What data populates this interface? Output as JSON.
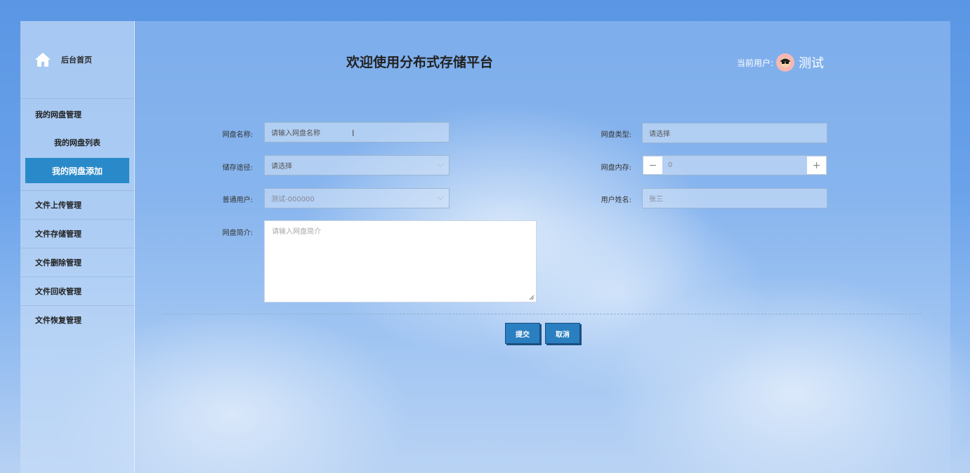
{
  "sidebar": {
    "home_label": "后台首页",
    "groups": [
      {
        "label": "我的网盘管理",
        "items": [
          {
            "label": "我的网盘列表"
          },
          {
            "label": "我的网盘添加"
          }
        ]
      }
    ],
    "menu": [
      {
        "label": "文件上传管理"
      },
      {
        "label": "文件存储管理"
      },
      {
        "label": "文件删除管理"
      },
      {
        "label": "文件回收管理"
      },
      {
        "label": "文件恢复管理"
      }
    ]
  },
  "header": {
    "title": "欢迎使用分布式存储平台",
    "current_user_label": "当前用户:",
    "current_user_name": "测试"
  },
  "form": {
    "disk_name": {
      "label": "网盘名称:",
      "placeholder": "请输入网盘名称"
    },
    "disk_type": {
      "label": "网盘类型:",
      "value": "请选择"
    },
    "storage_path": {
      "label": "储存途径:",
      "value": "请选择"
    },
    "disk_memory": {
      "label": "网盘内存:",
      "value": "0",
      "minus": "−",
      "plus": "+"
    },
    "normal_user": {
      "label": "普通用户:",
      "value": "测试-000000"
    },
    "user_name": {
      "label": "用户姓名:",
      "value": "张三"
    },
    "disk_intro": {
      "label": "网盘简介:",
      "placeholder": "请输入网盘简介"
    }
  },
  "buttons": {
    "submit": "提交",
    "cancel": "取消"
  },
  "colors": {
    "active_menu": "#2a8ac9",
    "button": "#2a7fc0",
    "avatar": "#f6b8b3"
  }
}
